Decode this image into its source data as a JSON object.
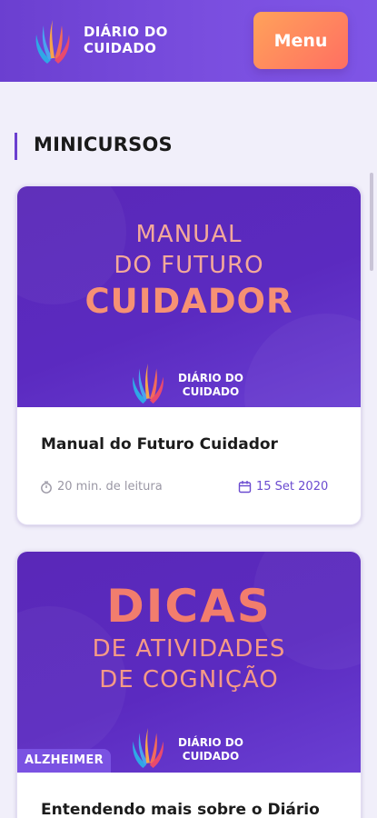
{
  "header": {
    "brand_line1": "DIÁRIO DO",
    "brand_line2": "CUIDADO",
    "menu_label": "Menu"
  },
  "section": {
    "title": "MINICURSOS"
  },
  "cards": [
    {
      "banner": {
        "line1": "MANUAL",
        "line2": "DO FUTURO",
        "line3": "CUIDADOR",
        "brand_line1": "DIÁRIO DO",
        "brand_line2": "CUIDADO"
      },
      "title": "Manual do Futuro Cuidador",
      "read_time": "20 min. de leitura",
      "date": "15 Set 2020"
    },
    {
      "banner": {
        "line1": "DICAS",
        "line2": "DE ATIVIDADES",
        "line3": "DE COGNIÇÃO",
        "brand_line1": "DIÁRIO DO",
        "brand_line2": "CUIDADO"
      },
      "tag": "ALZHEIMER",
      "title": "Entendendo mais sobre o Diário"
    }
  ],
  "colors": {
    "header_purple": "#6b3fd0",
    "accent_orange": "#ff8a5c",
    "date_purple": "#6b4bd0"
  },
  "icons": [
    "logo-hands-icon",
    "timer-icon",
    "calendar-icon"
  ]
}
